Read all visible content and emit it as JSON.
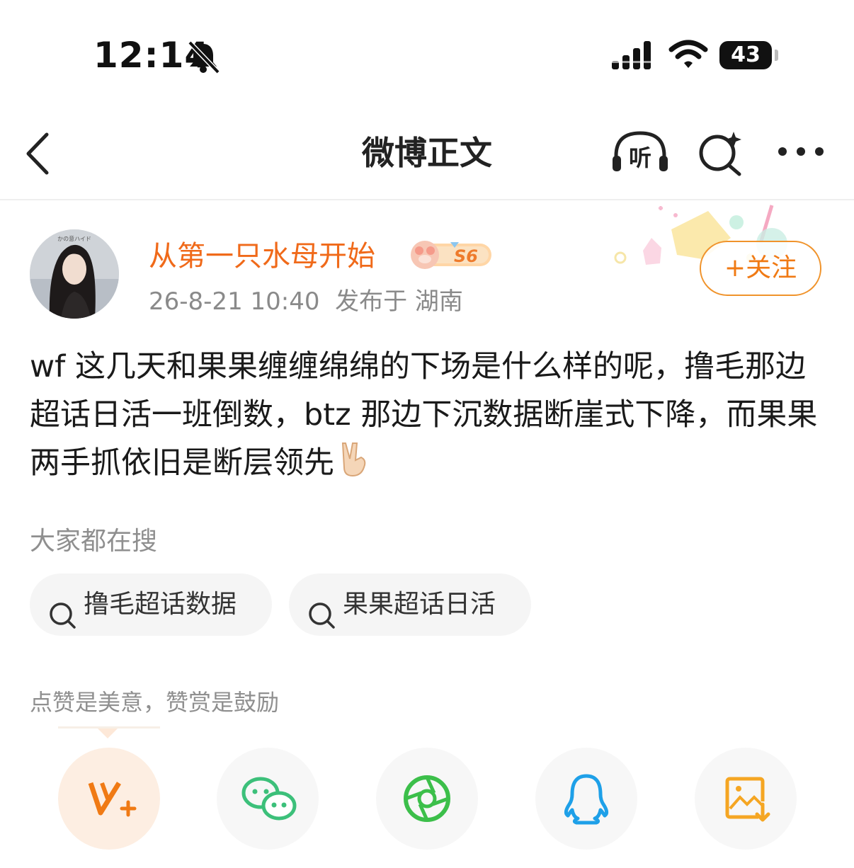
{
  "status_bar": {
    "time": "12:14",
    "battery": "43"
  },
  "header": {
    "title": "微博正文",
    "listen_label": "听"
  },
  "post": {
    "author": {
      "name": "从第一只水母开始",
      "level_badge": "S6",
      "avatar_text": "かの意ハイド"
    },
    "meta": "26-8-21 10:40  发布于 湖南",
    "follow_label": "+关注",
    "body": "wf 这几天和果果缠缠绵绵的下场是什么样的呢，撸毛那边超话日活一班倒数，btz 那边下沉数据断崖式下降，而果果两手抓依旧是断层领先"
  },
  "searches": {
    "title": "大家都在搜",
    "items": [
      "撸毛超话数据",
      "果果超话日活"
    ]
  },
  "reward": {
    "text": "点赞是美意，赞赏是鼓励"
  },
  "share": {
    "items": [
      {
        "icon": "v-plus-icon",
        "color": "#f07a14"
      },
      {
        "icon": "wechat-icon",
        "color": "#3cc07a"
      },
      {
        "icon": "moments-icon",
        "color": "#3cbf4a"
      },
      {
        "icon": "qq-icon",
        "color": "#1ea0e8"
      },
      {
        "icon": "save-image-icon",
        "color": "#f5a623"
      }
    ]
  },
  "colors": {
    "accent": "#f07a14",
    "username": "#f06a1a"
  }
}
